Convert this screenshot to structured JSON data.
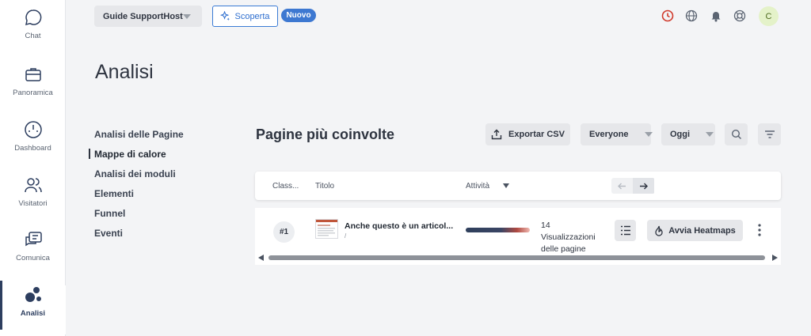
{
  "rail": {
    "items": [
      {
        "label": "Chat"
      },
      {
        "label": "Panoramica"
      },
      {
        "label": "Dashboard"
      },
      {
        "label": "Visitatori"
      },
      {
        "label": "Comunica"
      },
      {
        "label": "Analisi"
      }
    ]
  },
  "topbar": {
    "site_select": "Guide SupportHost",
    "discover_label": "Scoperta",
    "new_badge": "Nuovo",
    "avatar_initial": "C",
    "clock_color": "#d0392b"
  },
  "page": {
    "title": "Analisi"
  },
  "subnav": {
    "items": [
      {
        "label": "Analisi delle Pagine"
      },
      {
        "label": "Mappe di calore"
      },
      {
        "label": "Analisi dei moduli"
      },
      {
        "label": "Elementi"
      },
      {
        "label": "Funnel"
      },
      {
        "label": "Eventi"
      }
    ]
  },
  "section": {
    "title": "Pagine più coinvolte",
    "export_label": "Exportar CSV",
    "segment_label": "Everyone",
    "range_label": "Oggi"
  },
  "table": {
    "columns": {
      "rank": "Class...",
      "title": "Titolo",
      "activity": "Attività"
    },
    "rows": [
      {
        "rank": "#1",
        "title": "Anche questo è un articol...",
        "url": "/",
        "views": "14 Visualizzazioni delle pagine",
        "action_label": "Avvia Heatmaps"
      }
    ]
  },
  "colors": {
    "accent": "#3d78d1",
    "rail_active": "#2d3e5f"
  }
}
